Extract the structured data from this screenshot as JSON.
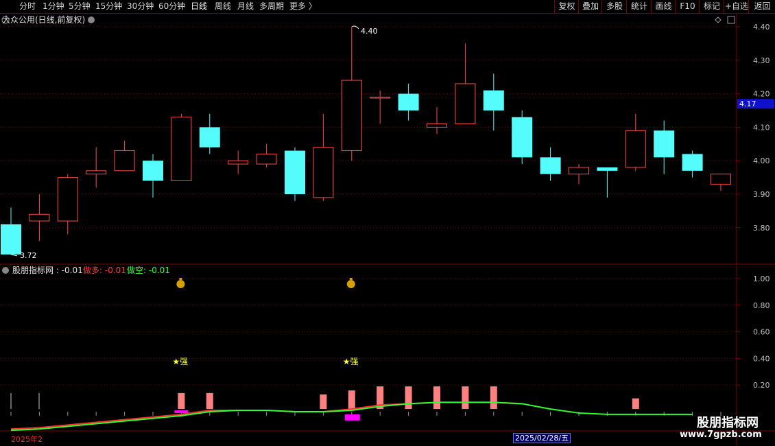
{
  "toolbar": {
    "items": [
      "分时",
      "1分钟",
      "5分钟",
      "15分钟",
      "30分钟",
      "60分钟",
      "日线",
      "周线",
      "月线",
      "多周期",
      "更多 〉"
    ],
    "active_index": 6,
    "right_items": [
      "复权",
      "叠加",
      "多股",
      "统计",
      "画线",
      "F10",
      "标记",
      "+自选",
      "返回"
    ]
  },
  "main_panel": {
    "title": "大众公用(日线,前复权)",
    "high_label": "4.40",
    "low_label": "3.72",
    "current_price": "4.17",
    "price_axis": [
      "4.40",
      "4.30",
      "4.20",
      "4.10",
      "4.00",
      "3.90",
      "3.80"
    ]
  },
  "indicator_panel": {
    "title": "股朋指标网 : -0.01",
    "label_long": "做多: -0.01",
    "label_short": "做空: -0.01",
    "axis": [
      "1.00",
      "0.80",
      "0.60",
      "0.40",
      "0.20"
    ],
    "signal_text": "★强",
    "year_label": "2025年2",
    "date_label": "2025/02/28/五"
  },
  "watermark": {
    "title": "股朋指标网",
    "url": "www.7gpzb.com"
  },
  "colors": {
    "up": "#ff4a4a",
    "down": "#54fcfc",
    "long_line": "#ff3030",
    "short_line": "#30ff30",
    "bar": "#ff8080",
    "magenta": "#ff00ff",
    "grid": "#7a0000",
    "axis_text": "#c0c0c0"
  },
  "chart_data": [
    {
      "type": "candlestick",
      "ylim": [
        3.7,
        4.43
      ],
      "candles": [
        {
          "open": 3.81,
          "close": 3.72,
          "high": 3.86,
          "low": 3.72
        },
        {
          "open": 3.82,
          "close": 3.84,
          "high": 3.9,
          "low": 3.76
        },
        {
          "open": 3.82,
          "close": 3.95,
          "high": 3.96,
          "low": 3.78
        },
        {
          "open": 3.96,
          "close": 3.97,
          "high": 4.04,
          "low": 3.92
        },
        {
          "open": 3.97,
          "close": 4.03,
          "high": 4.06,
          "low": 3.97
        },
        {
          "open": 4.0,
          "close": 3.94,
          "high": 4.02,
          "low": 3.89
        },
        {
          "open": 3.94,
          "close": 4.13,
          "high": 4.14,
          "low": 3.94
        },
        {
          "open": 4.1,
          "close": 4.04,
          "high": 4.14,
          "low": 4.02
        },
        {
          "open": 3.99,
          "close": 4.0,
          "high": 4.03,
          "low": 3.96
        },
        {
          "open": 3.99,
          "close": 4.02,
          "high": 4.05,
          "low": 3.98
        },
        {
          "open": 4.03,
          "close": 3.9,
          "high": 4.04,
          "low": 3.88
        },
        {
          "open": 3.89,
          "close": 4.04,
          "high": 4.14,
          "low": 3.88
        },
        {
          "open": 4.03,
          "close": 4.24,
          "high": 4.4,
          "low": 4.0
        },
        {
          "open": 4.19,
          "close": 4.19,
          "high": 4.21,
          "low": 4.11
        },
        {
          "open": 4.2,
          "close": 4.15,
          "high": 4.23,
          "low": 4.12
        },
        {
          "open": 4.1,
          "close": 4.11,
          "high": 4.16,
          "low": 4.08
        },
        {
          "open": 4.11,
          "close": 4.23,
          "high": 4.35,
          "low": 4.11
        },
        {
          "open": 4.21,
          "close": 4.15,
          "high": 4.26,
          "low": 4.09
        },
        {
          "open": 4.13,
          "close": 4.01,
          "high": 4.15,
          "low": 3.99
        },
        {
          "open": 4.01,
          "close": 3.96,
          "high": 4.04,
          "low": 3.94
        },
        {
          "open": 3.96,
          "close": 3.98,
          "high": 3.99,
          "low": 3.93
        },
        {
          "open": 3.98,
          "close": 3.97,
          "high": 3.98,
          "low": 3.89
        },
        {
          "open": 3.98,
          "close": 4.09,
          "high": 4.14,
          "low": 3.97
        },
        {
          "open": 4.09,
          "close": 4.01,
          "high": 4.12,
          "low": 3.96
        },
        {
          "open": 4.02,
          "close": 3.97,
          "high": 4.03,
          "low": 3.95
        },
        {
          "open": 3.93,
          "close": 3.96,
          "high": 3.96,
          "low": 3.91
        }
      ]
    },
    {
      "type": "indicator",
      "ylim": [
        -0.15,
        1.1
      ],
      "long_line": [
        -0.13,
        -0.12,
        -0.1,
        -0.08,
        -0.06,
        -0.04,
        -0.02,
        0.01,
        0.01,
        0.01,
        0.0,
        0.0,
        0.02,
        0.05,
        0.06,
        0.07,
        0.07,
        0.07,
        0.06
      ],
      "short_line": [
        -0.14,
        -0.13,
        -0.11,
        -0.09,
        -0.07,
        -0.05,
        -0.03,
        0.0,
        0.01,
        0.01,
        0.0,
        0.0,
        0.01,
        0.04,
        0.06,
        0.07,
        0.07,
        0.07,
        0.06,
        0.02,
        -0.01,
        -0.02,
        -0.02,
        -0.02,
        -0.02
      ],
      "bars": [
        {
          "index": 6,
          "value": 0.14
        },
        {
          "index": 7,
          "value": 0.14
        },
        {
          "index": 11,
          "value": 0.13
        },
        {
          "index": 12,
          "value": 0.16
        },
        {
          "index": 13,
          "value": 0.19
        },
        {
          "index": 14,
          "value": 0.19
        },
        {
          "index": 15,
          "value": 0.19
        },
        {
          "index": 16,
          "value": 0.19
        },
        {
          "index": 17,
          "value": 0.19
        },
        {
          "index": 22,
          "value": 0.1
        }
      ],
      "magenta_marks": [
        6,
        12
      ],
      "money_bag_indices": [
        6,
        12
      ],
      "strong_indices": [
        6,
        12
      ]
    }
  ]
}
